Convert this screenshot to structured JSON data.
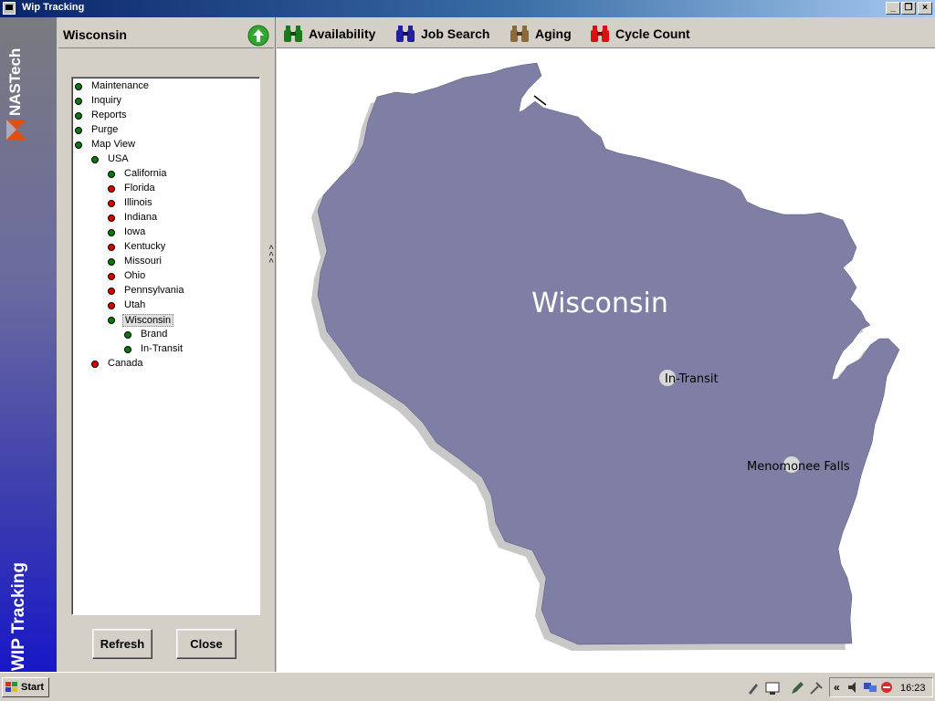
{
  "window": {
    "title": "Wip Tracking"
  },
  "brand": {
    "logo": "NASTech",
    "app_title": "WIP Tracking"
  },
  "panel": {
    "title": "Wisconsin"
  },
  "tree": [
    {
      "label": "Maintenance",
      "status": "green",
      "level": 0
    },
    {
      "label": "Inquiry",
      "status": "green",
      "level": 0
    },
    {
      "label": "Reports",
      "status": "green",
      "level": 0
    },
    {
      "label": "Purge",
      "status": "green",
      "level": 0
    },
    {
      "label": "Map View",
      "status": "green",
      "level": 0
    },
    {
      "label": "USA",
      "status": "green",
      "level": 1
    },
    {
      "label": "California",
      "status": "green",
      "level": 2
    },
    {
      "label": "Florida",
      "status": "red",
      "level": 2
    },
    {
      "label": "Illinois",
      "status": "red",
      "level": 2
    },
    {
      "label": "Indiana",
      "status": "red",
      "level": 2
    },
    {
      "label": "Iowa",
      "status": "green",
      "level": 2
    },
    {
      "label": "Kentucky",
      "status": "red",
      "level": 2
    },
    {
      "label": "Missouri",
      "status": "green",
      "level": 2
    },
    {
      "label": "Ohio",
      "status": "red",
      "level": 2
    },
    {
      "label": "Pennsylvania",
      "status": "red",
      "level": 2
    },
    {
      "label": "Utah",
      "status": "red",
      "level": 2
    },
    {
      "label": "Wisconsin",
      "status": "green",
      "level": 2,
      "selected": true
    },
    {
      "label": "Brand",
      "status": "green",
      "level": 3
    },
    {
      "label": "In-Transit",
      "status": "green",
      "level": 3
    },
    {
      "label": "Canada",
      "status": "red",
      "level": 1
    }
  ],
  "buttons": {
    "refresh": "Refresh",
    "close": "Close"
  },
  "toolbar": {
    "availability": "Availability",
    "job_search": "Job Search",
    "aging": "Aging",
    "cycle_count": "Cycle Count"
  },
  "map": {
    "state_label": "Wisconsin",
    "locations": [
      "In-Transit",
      "Menomonee Falls"
    ]
  },
  "taskbar": {
    "start": "Start",
    "clock": "16:23",
    "tray_chevron": "«"
  },
  "colors": {
    "status_green": "#0a7a0a",
    "status_red": "#dd0000",
    "state_fill": "#7f7fa5",
    "state_shadow": "#c8c8c8",
    "titlebar": "#0a246a",
    "brand_bottom": "#1818c8"
  },
  "icons": {
    "up": "up-arrow-icon",
    "availability": "binoculars-green-icon",
    "job_search": "binoculars-blue-icon",
    "aging": "binoculars-brown-icon",
    "cycle_count": "binoculars-red-icon"
  }
}
